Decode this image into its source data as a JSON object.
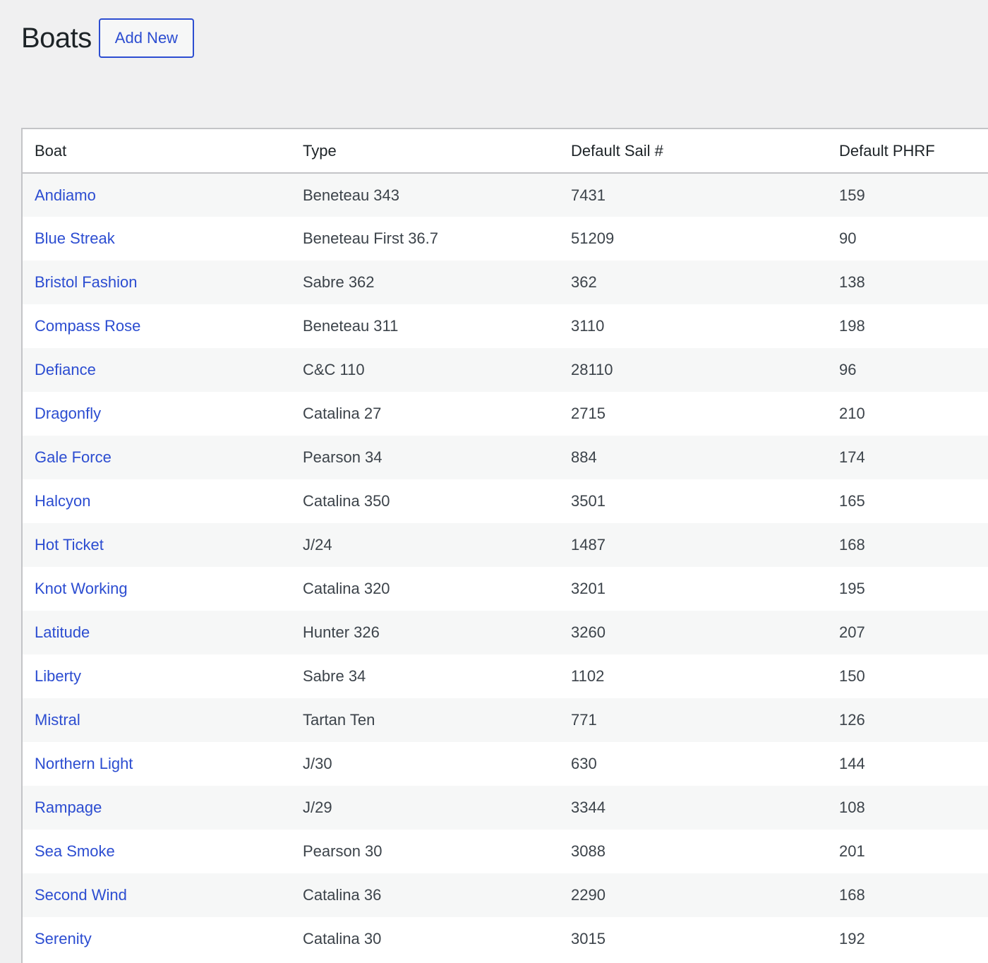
{
  "header": {
    "title": "Boats",
    "add_new_label": "Add New"
  },
  "table": {
    "columns": [
      "Boat",
      "Type",
      "Default Sail #",
      "Default PHRF"
    ],
    "rows": [
      [
        "Andiamo",
        "Beneteau 343",
        "7431",
        "159"
      ],
      [
        "Blue Streak",
        "Beneteau First 36.7",
        "51209",
        "90"
      ],
      [
        "Bristol Fashion",
        "Sabre 362",
        "362",
        "138"
      ],
      [
        "Compass Rose",
        "Beneteau 311",
        "3110",
        "198"
      ],
      [
        "Defiance",
        "C&C 110",
        "28110",
        "96"
      ],
      [
        "Dragonfly",
        "Catalina 27",
        "2715",
        "210"
      ],
      [
        "Gale Force",
        "Pearson 34",
        "884",
        "174"
      ],
      [
        "Halcyon",
        "Catalina 350",
        "3501",
        "165"
      ],
      [
        "Hot Ticket",
        "J/24",
        "1487",
        "168"
      ],
      [
        "Knot Working",
        "Catalina 320",
        "3201",
        "195"
      ],
      [
        "Latitude",
        "Hunter 326",
        "3260",
        "207"
      ],
      [
        "Liberty",
        "Sabre 34",
        "1102",
        "150"
      ],
      [
        "Mistral",
        "Tartan Ten",
        "771",
        "126"
      ],
      [
        "Northern Light",
        "J/30",
        "630",
        "144"
      ],
      [
        "Rampage",
        "J/29",
        "3344",
        "108"
      ],
      [
        "Sea Smoke",
        "Pearson 30",
        "3088",
        "201"
      ],
      [
        "Second Wind",
        "Catalina 36",
        "2290",
        "168"
      ],
      [
        "Serenity",
        "Catalina 30",
        "3015",
        "192"
      ]
    ]
  },
  "colors": {
    "link": "#2c4dd1",
    "background": "#f0f0f1",
    "row_alt": "#f6f7f7",
    "border": "#c3c4c7"
  }
}
